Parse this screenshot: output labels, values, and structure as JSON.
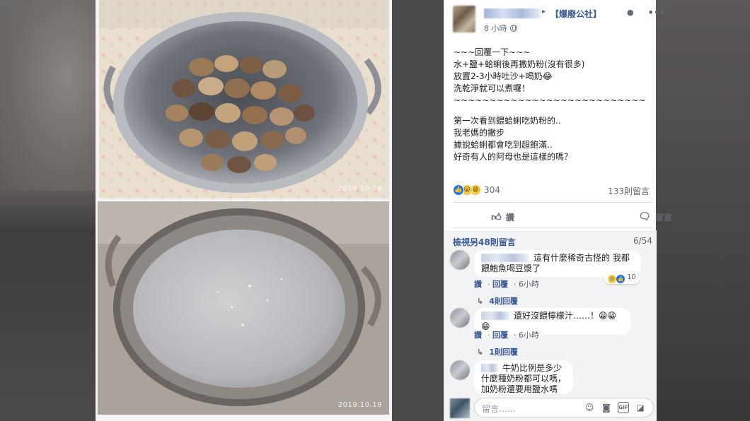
{
  "photos": {
    "top_date": "2019.10.19",
    "bottom_date": "2019.10.19"
  },
  "post": {
    "group_name": "【爆廢公社】",
    "time": "8 小時",
    "body_lines": [
      "~~~回覆一下~~~",
      "水+鹽+蛤蜊後再撒奶粉(沒有很多)",
      "放置2-3小時吐沙+喝奶😂",
      "洗乾淨就可以煮囉！",
      "~~~~~~~~~~~~~~~~~~~~~~~~~~~"
    ],
    "body_lines_2": [
      "第一次看到餵蛤蜊吃奶粉的..",
      "我老媽的撇步",
      "據說蛤蜊都會吃到超飽滿..",
      "好奇有人的阿母也是這樣的嗎？"
    ],
    "reaction_count": "304",
    "comment_count": "133則留言",
    "like_label": "讚",
    "comment_label": "留言"
  },
  "comments_section": {
    "more_comments": "檢視另48則留言",
    "pager": "6/54",
    "comments": [
      {
        "text": "這有什麼稀奇古怪的 我都餵鮑魚喝豆漿了",
        "like": "讚",
        "reply": "回覆",
        "time": "6小時",
        "reactions": "10",
        "replies": "4則回覆"
      },
      {
        "text": "還好沒餵檸檬汁……！😁😁😁",
        "like": "讚",
        "reply": "回覆",
        "time": "6小時",
        "replies": "1則回覆"
      },
      {
        "text": "牛奶比例是多少 什麼種奶粉都可以嗎，加奶粉還要用鹽水嗎"
      }
    ],
    "write_placeholder": "留言……"
  },
  "icons": {
    "more": "more-horizontal-icon",
    "globe": "globe-icon",
    "like": "thumbs-up-icon",
    "comment": "speech-bubble-icon",
    "emoji": "emoji-icon",
    "camera": "camera-icon",
    "gif": "gif-icon",
    "sticker": "sticker-icon"
  },
  "colors": {
    "link": "#385898",
    "like_blue": "#1877f2",
    "secondary_text": "#606770"
  }
}
